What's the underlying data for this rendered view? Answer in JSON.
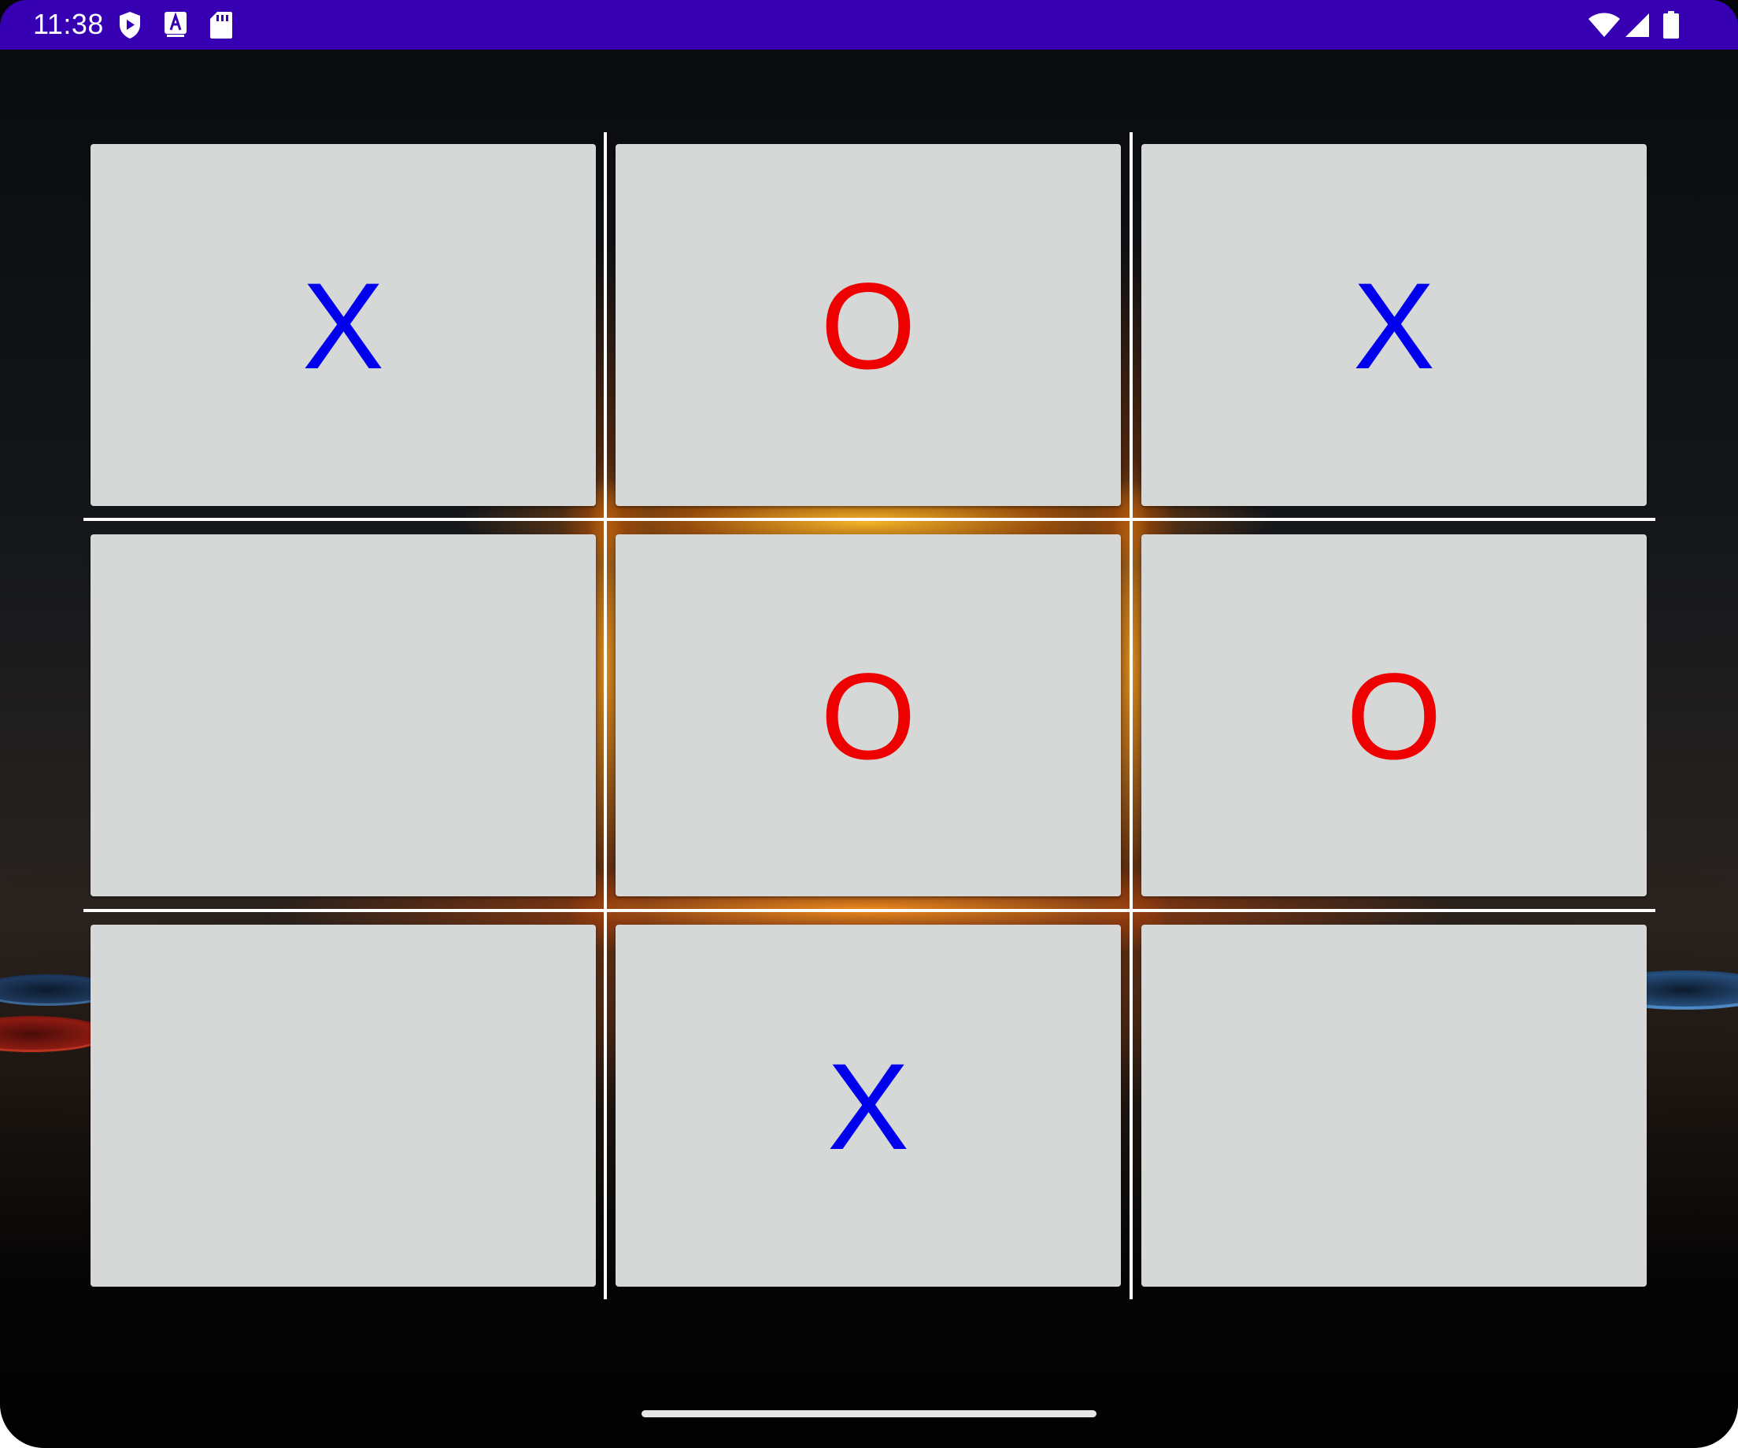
{
  "status_bar": {
    "time": "11:38",
    "left_icons": [
      "shield-play-icon",
      "font-a-icon",
      "sd-card-icon"
    ],
    "right_icons": [
      "wifi-icon",
      "cell-signal-icon",
      "battery-icon"
    ],
    "background_color": "#3700b3"
  },
  "board": {
    "cells": [
      {
        "mark": "X",
        "color": "#0000ee"
      },
      {
        "mark": "O",
        "color": "#ee0000"
      },
      {
        "mark": "X",
        "color": "#0000ee"
      },
      {
        "mark": "",
        "color": ""
      },
      {
        "mark": "O",
        "color": "#ee0000"
      },
      {
        "mark": "O",
        "color": "#ee0000"
      },
      {
        "mark": "",
        "color": ""
      },
      {
        "mark": "X",
        "color": "#0000ee"
      },
      {
        "mark": "",
        "color": ""
      }
    ],
    "cell_color": "#d6d7d7",
    "grid_line_color": "#ffffff"
  },
  "colors": {
    "x_color": "#0000ee",
    "o_color": "#ee0000"
  }
}
